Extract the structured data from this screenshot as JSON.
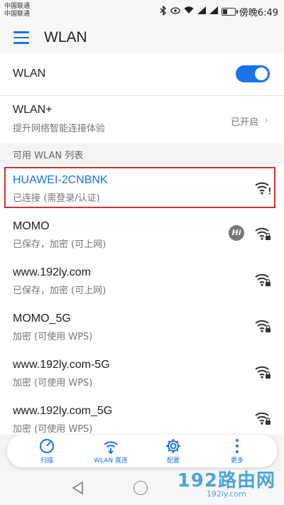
{
  "status_bar": {
    "carrier_1": "中国联通",
    "carrier_2": "中国联通",
    "time": "傍晚6:49",
    "battery_level": 0.45,
    "icons": [
      "bluetooth-icon",
      "eye-icon",
      "wifi-icon",
      "signal-icon",
      "signal-icon",
      "battery-icon"
    ]
  },
  "app_bar": {
    "title": "WLAN"
  },
  "wlan_toggle": {
    "label": "WLAN",
    "on": true
  },
  "wlan_plus": {
    "title": "WLAN+",
    "subtitle": "提升网络智能连接体验",
    "status": "已开启"
  },
  "section_header": "可用 WLAN 列表",
  "networks": [
    {
      "name": "HUAWEI-2CNBNK",
      "status": "已连接 (需登录/认证)",
      "connected": true
    },
    {
      "name": "MOMO",
      "status": "已保存，加密 (可上网)",
      "hi": "Hi"
    },
    {
      "name": "www.192ly.com",
      "status": "已保存，加密 (可上网)"
    },
    {
      "name": "MOMO_5G",
      "status": "加密 (可使用 WPS)"
    },
    {
      "name": "www.192ly.com-5G",
      "status": "加密 (可使用 WPS)"
    },
    {
      "name": "www.192ly.com_5G",
      "status": "加密 (可使用 WPS)"
    }
  ],
  "toolbar": {
    "scan": "扫描",
    "wlan_direct": "WLAN 直连",
    "config": "配置",
    "more": "更多"
  },
  "watermark": {
    "main": "192路由网",
    "sub": "192ly.com"
  },
  "colors": {
    "accent": "#1a73e8",
    "highlight": "#d32f2f"
  }
}
